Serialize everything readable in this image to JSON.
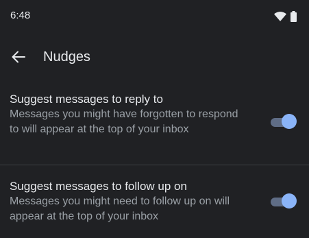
{
  "status_bar": {
    "time": "6:48"
  },
  "header": {
    "title": "Nudges"
  },
  "settings": [
    {
      "title": "Suggest messages to reply to",
      "description": "Messages you might have forgotten to respond to will appear at the top of your inbox",
      "enabled": true
    },
    {
      "title": "Suggest messages to follow up on",
      "description": "Messages you might need to follow up on will appear at the top of your inbox",
      "enabled": true
    }
  ],
  "colors": {
    "background": "#202124",
    "accent": "#8ab4f8",
    "track": "#5f6d86",
    "text_primary": "#e8eaed",
    "text_secondary": "#9aa0a6"
  }
}
